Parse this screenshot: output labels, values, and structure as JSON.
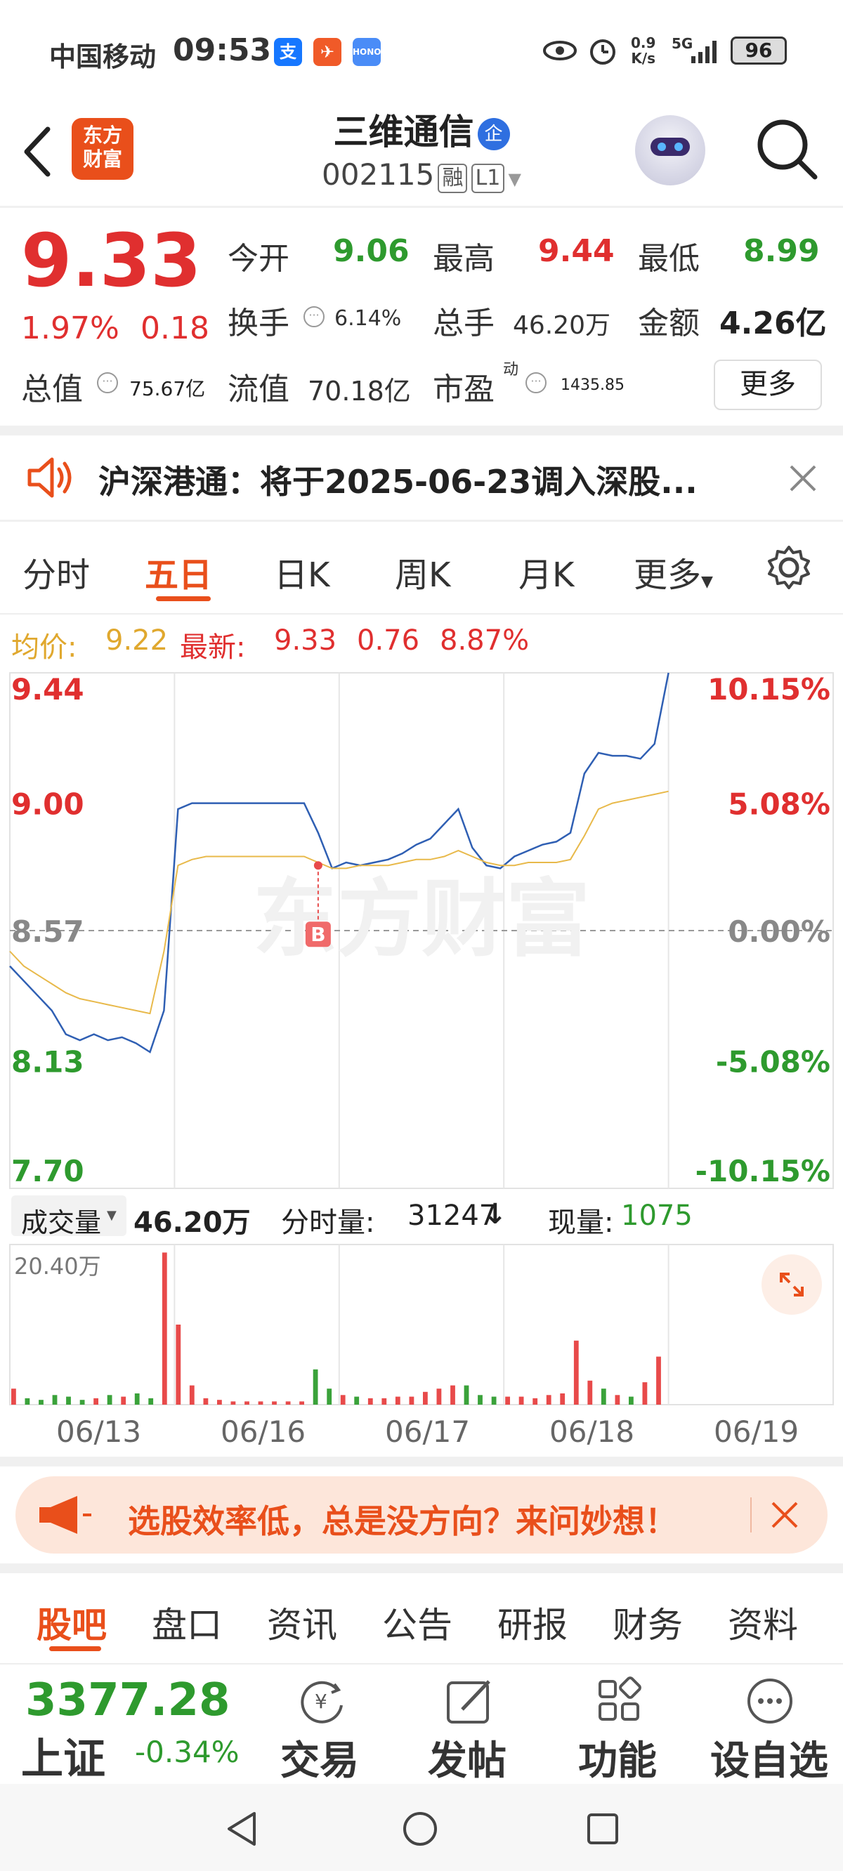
{
  "status_bar": {
    "carrier": "中国移动",
    "time": "09:53",
    "net_speed": "0.9\nK/s",
    "net_speed_top": "0.9",
    "net_speed_bottom": "K/s",
    "signal": "5G",
    "battery": "96"
  },
  "header": {
    "logo_line1": "东方",
    "logo_line2": "财富",
    "stock_name": "三维通信",
    "badge": "企",
    "stock_code": "002115",
    "tag_margin": "融",
    "tag_level": "L1"
  },
  "quote": {
    "price": "9.33",
    "change_pct": "1.97%",
    "change_amt": "0.18",
    "open_label": "今开",
    "open_value": "9.06",
    "high_label": "最高",
    "high_value": "9.44",
    "low_label": "最低",
    "low_value": "8.99",
    "turnover_label": "换手",
    "turnover_value": "6.14%",
    "volume_label": "总手",
    "volume_value": "46.20万",
    "amount_label": "金额",
    "amount_value": "4.26亿",
    "mktcap_label": "总值",
    "mktcap_value": "75.67亿",
    "float_label": "流值",
    "float_value": "70.18亿",
    "pe_label": "市盈",
    "pe_sup": "动",
    "pe_value": "1435.85",
    "more_button": "更多"
  },
  "notice": {
    "text": "沪深港通：将于2025-06-23调入深股..."
  },
  "chart_tabs": [
    "分时",
    "五日",
    "日K",
    "周K",
    "月K",
    "更多"
  ],
  "chart_tab_active": "五日",
  "price_info": {
    "avg_label": "均价:",
    "avg_value": "9.22",
    "latest_label": "最新:",
    "latest_value": "9.33",
    "latest_change": "0.76",
    "latest_pct": "8.87%"
  },
  "chart_data": {
    "type": "line",
    "title": "",
    "watermark": "东方财富",
    "y_ticks_left": [
      "9.44",
      "9.00",
      "8.57",
      "8.13",
      "7.70"
    ],
    "y_ticks_right": [
      "10.15%",
      "5.08%",
      "0.00%",
      "-5.08%",
      "-10.15%"
    ],
    "ylim": [
      7.7,
      9.44
    ],
    "prev_close": 8.57,
    "days": [
      "06/13",
      "06/16",
      "06/17",
      "06/18",
      "06/19"
    ],
    "series": [
      {
        "name": "price",
        "color": "#2f5fb3",
        "values": [
          8.45,
          8.4,
          8.35,
          8.3,
          8.22,
          8.2,
          8.22,
          8.2,
          8.21,
          8.19,
          8.16,
          8.3,
          8.98,
          9.0,
          9.0,
          9.0,
          9.0,
          9.0,
          9.0,
          9.0,
          9.0,
          9.0,
          8.9,
          8.78,
          8.8,
          8.79,
          8.8,
          8.81,
          8.83,
          8.86,
          8.88,
          8.93,
          8.98,
          8.85,
          8.79,
          8.78,
          8.82,
          8.84,
          8.86,
          8.87,
          8.9,
          9.1,
          9.17,
          9.16,
          9.16,
          9.15,
          9.2,
          9.44
        ]
      },
      {
        "name": "avg",
        "color": "#e8b94a",
        "values": [
          8.5,
          8.45,
          8.42,
          8.39,
          8.36,
          8.34,
          8.33,
          8.32,
          8.31,
          8.3,
          8.29,
          8.5,
          8.79,
          8.81,
          8.82,
          8.82,
          8.82,
          8.82,
          8.82,
          8.82,
          8.82,
          8.82,
          8.8,
          8.78,
          8.78,
          8.79,
          8.79,
          8.79,
          8.8,
          8.81,
          8.81,
          8.82,
          8.84,
          8.82,
          8.8,
          8.79,
          8.79,
          8.8,
          8.8,
          8.8,
          8.81,
          8.89,
          8.98,
          9.0,
          9.01,
          9.02,
          9.03,
          9.04
        ]
      }
    ],
    "marker": {
      "label": "B",
      "price": 8.79
    }
  },
  "volume": {
    "selector_label": "成交量",
    "total": "46.20万",
    "tick_label": "分时量:",
    "tick_value": "31247",
    "tick_arrow": "↓",
    "current_label": "现量:",
    "current_value": "1075",
    "max_label": "20.40万",
    "bars": [
      0.1,
      0.04,
      0.03,
      0.06,
      0.05,
      0.03,
      0.04,
      0.06,
      0.05,
      0.07,
      0.04,
      0.95,
      0.5,
      0.12,
      0.04,
      0.03,
      0.02,
      0.02,
      0.02,
      0.02,
      0.02,
      0.02,
      0.22,
      0.1,
      0.06,
      0.05,
      0.04,
      0.04,
      0.05,
      0.05,
      0.08,
      0.1,
      0.12,
      0.12,
      0.06,
      0.05,
      0.05,
      0.05,
      0.04,
      0.06,
      0.07,
      0.4,
      0.15,
      0.1,
      0.06,
      0.05,
      0.14,
      0.3
    ]
  },
  "ad_banner": {
    "text": "选股效率低，总是没方向？来问妙想！"
  },
  "news_tabs": [
    "股吧",
    "盘口",
    "资讯",
    "公告",
    "研报",
    "财务",
    "资料"
  ],
  "news_tab_active": "股吧",
  "bottom_bar": {
    "index_value": "3377.28",
    "index_name": "上证",
    "index_change": "-0.34%",
    "trade_label": "交易",
    "post_label": "发帖",
    "function_label": "功能",
    "watch_label": "设自选"
  }
}
